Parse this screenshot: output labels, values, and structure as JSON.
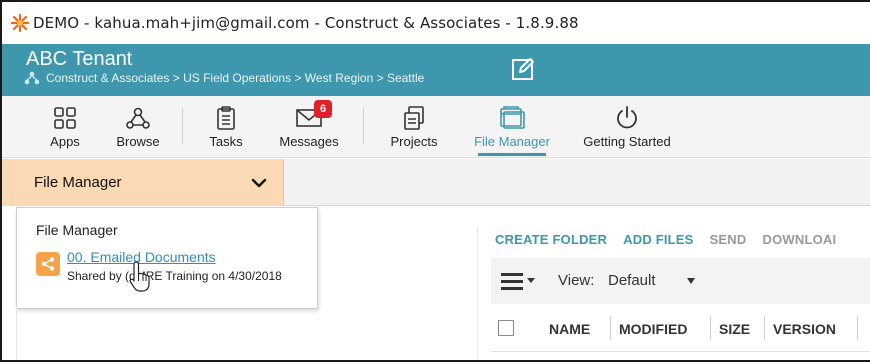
{
  "window": {
    "title": "DEMO - kahua.mah+jim@gmail.com - Construct & Associates - 1.8.9.88",
    "logo_icon": "kahua-logo-icon"
  },
  "tenant": {
    "name": "ABC Tenant",
    "breadcrumb": "Construct & Associates > US Field Operations > West Region > Seattle",
    "edit_icon": "edit-icon",
    "background": "#3e97ad"
  },
  "toolbar": {
    "items": [
      {
        "label": "Apps",
        "icon": "apps-grid-icon"
      },
      {
        "label": "Browse",
        "icon": "browse-network-icon"
      },
      {
        "label": "Tasks",
        "icon": "tasks-clipboard-icon"
      },
      {
        "label": "Messages",
        "icon": "envelope-icon",
        "badge": "6"
      },
      {
        "label": "Projects",
        "icon": "projects-icon"
      },
      {
        "label": "File Manager",
        "icon": "file-manager-icon",
        "active": true
      },
      {
        "label": "Getting Started",
        "icon": "power-icon"
      }
    ],
    "accent": "#3e97ad",
    "badge_color": "#e0202a"
  },
  "module_selector": {
    "label": "File Manager",
    "background": "#fbd9b4"
  },
  "dropdown": {
    "header": "File Manager",
    "item_link": "00. Emailed Documents",
    "item_sub": "Shared by (dMRE Training on 4/30/2018",
    "share_icon_color": "#f5a24a"
  },
  "actions": {
    "create_folder": "CREATE FOLDER",
    "add_files": "ADD FILES",
    "send": "SEND",
    "download": "DOWNLOAI"
  },
  "view": {
    "label": "View:",
    "value": "Default"
  },
  "table": {
    "columns": [
      "NAME",
      "MODIFIED",
      "SIZE",
      "VERSION"
    ]
  }
}
